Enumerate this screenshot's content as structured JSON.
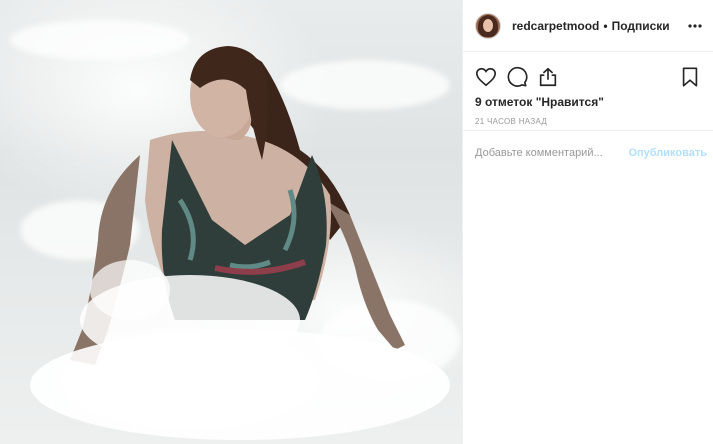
{
  "post": {
    "username": "redcarpetmood",
    "separator": "•",
    "follow_label": "Подписки",
    "likes_text": "9 отметок \"Нравится\"",
    "time_ago": "21 часов назад",
    "comment_placeholder": "Добавьте комментарий...",
    "publish_label": "Опубликовать"
  },
  "icons": [
    "avatar-image",
    "more-options-icon",
    "heart-icon",
    "comment-icon",
    "share-icon",
    "bookmark-icon"
  ],
  "colors": {
    "text": "#262626",
    "muted": "#999999",
    "publish_disabled": "#b2dffc",
    "divider": "#efefef"
  }
}
